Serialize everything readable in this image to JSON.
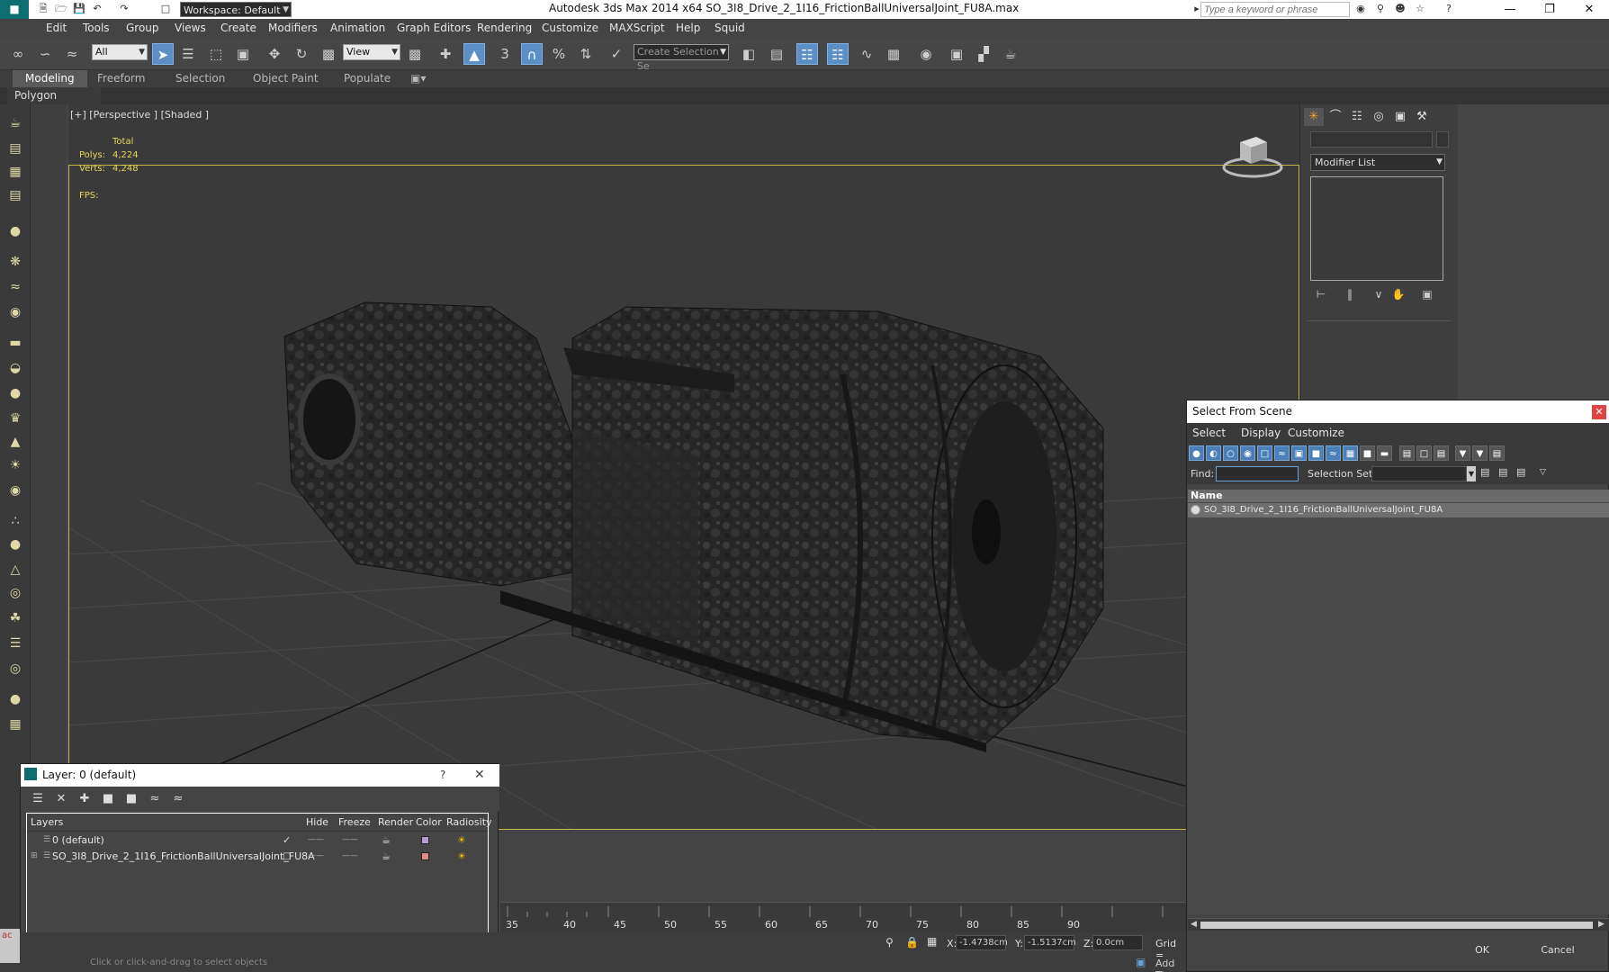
{
  "window": {
    "title": "Autodesk 3ds Max  2014 x64     SO_3I8_Drive_2_1I16_FrictionBallUniversalJoint_FU8A.max",
    "workspace": "Workspace: Default",
    "search_placeholder": "Type a keyword or phrase"
  },
  "menu": [
    "Edit",
    "Tools",
    "Group",
    "Views",
    "Create",
    "Modifiers",
    "Animation",
    "Graph Editors",
    "Rendering",
    "Customize",
    "MAXScript",
    "Help",
    "Squid"
  ],
  "toolbar": {
    "selection_filter": "All",
    "ref_coord": "View",
    "selection_set": "Create Selection Se"
  },
  "ribbon": {
    "tabs": [
      "Modeling",
      "Freeform",
      "Selection",
      "Object Paint",
      "Populate"
    ],
    "active_tab": "Modeling",
    "panel_label": "Polygon Modeling"
  },
  "viewport": {
    "label": "[+] [Perspective ] [Shaded ]",
    "stats": {
      "header": "Total",
      "polys_label": "Polys:",
      "polys_value": "4,224",
      "verts_label": "Verts:",
      "verts_value": "4,248",
      "fps_label": "FPS:"
    }
  },
  "command_panel": {
    "modifier_list": "Modifier List"
  },
  "select_from_scene": {
    "title": "Select From Scene",
    "menu": [
      "Select",
      "Display",
      "Customize"
    ],
    "find_label": "Find:",
    "selection_set_label": "Selection Set:",
    "column_name": "Name",
    "rows": [
      "SO_3I8_Drive_2_1I16_FrictionBallUniversalJoint_FU8A"
    ],
    "ok": "OK",
    "cancel": "Cancel"
  },
  "layer_dialog": {
    "title": "Layer: 0 (default)",
    "help": "?",
    "columns": [
      "Layers",
      "Hide",
      "Freeze",
      "Render",
      "Color",
      "Radiosity"
    ],
    "rows": [
      {
        "name": "0 (default)",
        "color": "#b59ad8"
      },
      {
        "name": "SO_3I8_Drive_2_1I16_FrictionBallUniversalJoint_FU8A",
        "color": "#e08a8a"
      }
    ]
  },
  "timeline": {
    "ticks": [
      "35",
      "40",
      "45",
      "50",
      "55",
      "60",
      "65",
      "70",
      "75",
      "80",
      "85",
      "90"
    ]
  },
  "status": {
    "x_label": "X:",
    "x_value": "-1.4738cm",
    "y_label": "Y:",
    "y_value": "-1.5137cm",
    "z_label": "Z:",
    "z_value": "0.0cm",
    "grid_label": "Grid =",
    "add_time_tag": "Add Ti",
    "prompt": "Click or click-and-drag to select objects",
    "maxscript_mini": "ac"
  },
  "colors": {
    "accent_blue": "#5b8fc6",
    "viewport_border": "#c8b84a",
    "stats_text": "#e5d75a",
    "logo": "#0c6e6e"
  }
}
